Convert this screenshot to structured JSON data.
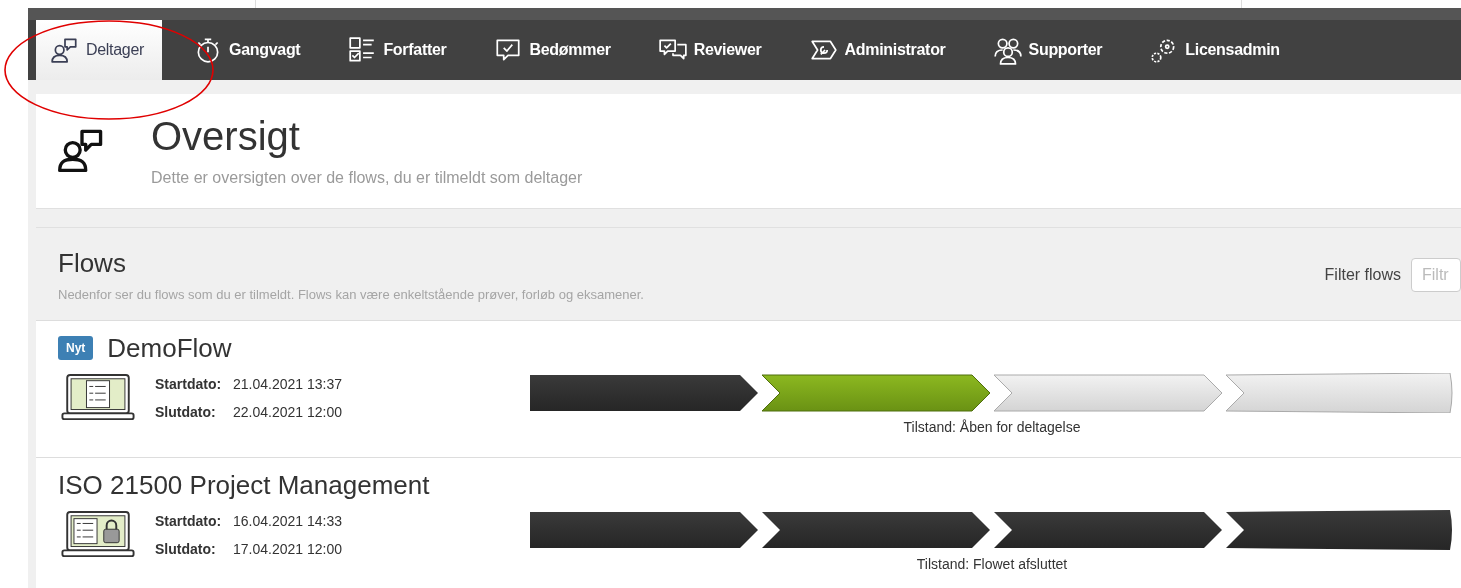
{
  "tabs": [
    {
      "label": "Deltager",
      "selected": true
    },
    {
      "label": "Gangvagt",
      "selected": false
    },
    {
      "label": "Forfatter",
      "selected": false
    },
    {
      "label": "Bedømmer",
      "selected": false
    },
    {
      "label": "Reviewer",
      "selected": false
    },
    {
      "label": "Administrator",
      "selected": false
    },
    {
      "label": "Supporter",
      "selected": false
    },
    {
      "label": "Licensadmin",
      "selected": false
    }
  ],
  "header": {
    "title": "Oversigt",
    "subtitle": "Dette er oversigten over de flows, du er tilmeldt som deltager"
  },
  "flows_panel": {
    "title": "Flows",
    "description": "Nedenfor ser du flows som du er tilmeldt. Flows kan være enkeltstående prøver, forløb og eksamener.",
    "filter_label": "Filter flows",
    "filter_placeholder": "Filtr"
  },
  "flows": [
    {
      "badge": "Nyt",
      "name": "DemoFlow",
      "locked": false,
      "start_label": "Startdato:",
      "start": "21.04.2021 13:37",
      "end_label": "Slutdato:",
      "end": "22.04.2021 12:00",
      "steps": [
        {
          "completed": true,
          "current": false
        },
        {
          "completed": false,
          "current": true
        },
        {
          "completed": false,
          "current": false
        },
        {
          "completed": false,
          "current": false
        }
      ],
      "status": "Tilstand: Åben for deltagelse"
    },
    {
      "name": "ISO 21500 Project Management",
      "locked": true,
      "start_label": "Startdato:",
      "start": "16.04.2021 14:33",
      "end_label": "Slutdato:",
      "end": "17.04.2021 12:00",
      "steps": [
        {
          "completed": true,
          "current": false
        },
        {
          "completed": true,
          "current": false
        },
        {
          "completed": true,
          "current": false
        },
        {
          "completed": true,
          "current": false
        }
      ],
      "status": "Tilstand: Flowet afsluttet"
    }
  ]
}
